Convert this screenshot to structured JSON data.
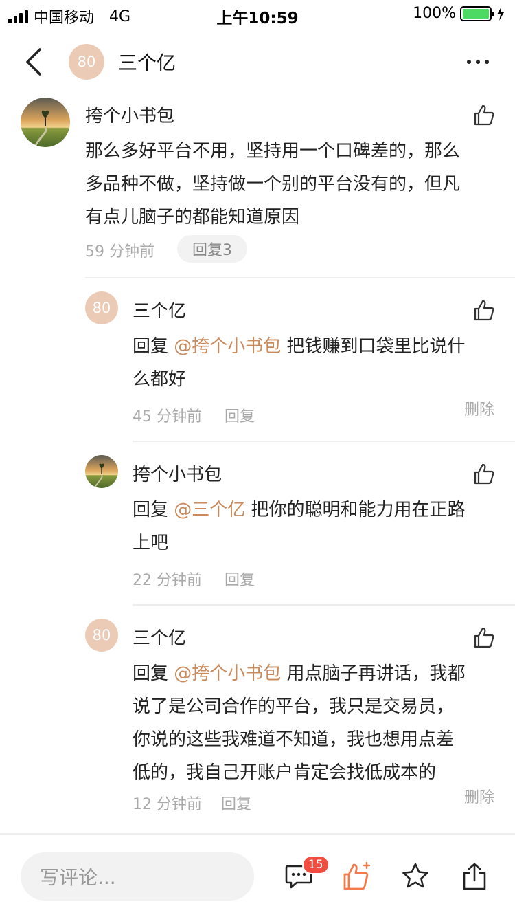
{
  "status_bar": {
    "carrier": "中国移动",
    "network": "4G",
    "time": "上午10:59",
    "battery": "100%"
  },
  "header": {
    "avatar_text": "80",
    "title": "三个亿"
  },
  "main_comment": {
    "author": "挎个小书包",
    "lines": [
      "那么多好平台不用，坚持用一个口碑差的，那么",
      "多品种不做，坚持做一个别的平台没有的，但凡",
      "有点儿脑子的都能知道原因"
    ],
    "time": "59 分钟前",
    "reply_chip": "回复3"
  },
  "replies": [
    {
      "author": "三个亿",
      "avatar_text": "80",
      "prefix": "回复 ",
      "mention": "@挎个小书包",
      "lines": [
        " 把钱赚到口袋里比说什",
        "么都好"
      ],
      "time": "45 分钟前",
      "reply_label": "回复",
      "delete_label": "删除"
    },
    {
      "author": "挎个小书包",
      "prefix": "回复 ",
      "mention": "@三个亿",
      "lines": [
        " 把你的聪明和能力用在正路",
        "上吧"
      ],
      "time": "22 分钟前",
      "reply_label": "回复"
    },
    {
      "author": "三个亿",
      "avatar_text": "80",
      "prefix": "回复 ",
      "mention": "@挎个小书包",
      "lines": [
        " 用点脑子再讲话，我都",
        "说了是公司合作的平台，我只是交易员，",
        "你说的这些我难道不知道，我也想用点差",
        "低的，我自己开账户肯定会找低成本的"
      ],
      "time": "12 分钟前",
      "reply_label": "回复",
      "delete_label": "删除"
    }
  ],
  "bottom_bar": {
    "placeholder": "写评论...",
    "comment_count": "15"
  },
  "colors": {
    "accent": "#c98a5c",
    "avatar_bg": "#ebcbb5",
    "badge": "#f24b3f",
    "like_active": "#f47a4c",
    "battery": "#4cd964"
  }
}
